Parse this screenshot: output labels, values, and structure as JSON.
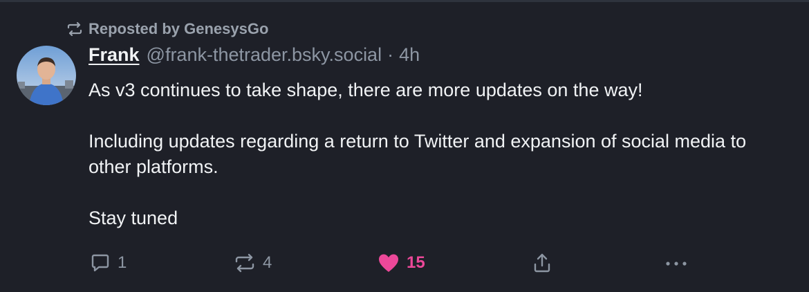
{
  "repost": {
    "label": "Reposted by GenesysGo",
    "icon": "repost-icon"
  },
  "post": {
    "author_name": "Frank",
    "handle": "@frank-thetrader.bsky.social",
    "separator": "·",
    "time": "4h",
    "paragraphs": [
      "As v3 continues to take shape, there are more updates on the way!",
      "Including updates regarding a return to Twitter and expansion of social media to other platforms.",
      "Stay tuned"
    ]
  },
  "actions": {
    "reply": {
      "icon": "reply-icon",
      "count": "1"
    },
    "repost": {
      "icon": "repost-icon",
      "count": "4"
    },
    "like": {
      "icon": "heart-icon",
      "count": "15",
      "liked": true
    },
    "share": {
      "icon": "share-icon"
    },
    "more": {
      "icon": "more-icon"
    }
  },
  "colors": {
    "background": "#1e2028",
    "text": "#f1f3f5",
    "muted": "#8d96a3",
    "like": "#ec4899"
  }
}
